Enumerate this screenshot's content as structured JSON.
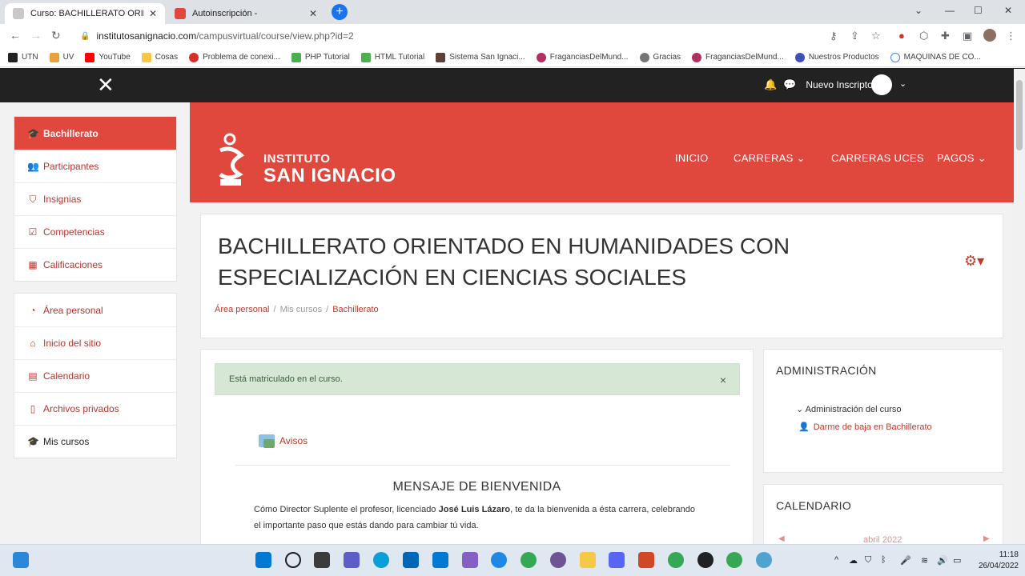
{
  "browser": {
    "tabs": [
      {
        "title": "Curso: BACHILLERATO ORIENTAD",
        "active": true
      },
      {
        "title": "Autoinscripción -",
        "active": false
      }
    ],
    "url_host": "institutosanignacio.com",
    "url_path": "/campusvirtual/course/view.php?id=2",
    "bookmarks": [
      "UTN",
      "UV",
      "YouTube",
      "Cosas",
      "Problema de conexi...",
      "PHP Tutorial",
      "HTML Tutorial",
      "Sistema San Ignaci...",
      "FraganciasDelMund...",
      "Gracias",
      "FraganciasDelMund...",
      "Nuestros Productos",
      "MAQUINAS DE CO..."
    ]
  },
  "moodle_nav": {
    "close_glyph": "✕",
    "user_name": "Nuevo Inscripto"
  },
  "sidebar": {
    "group1": [
      {
        "label": "Bachillerato",
        "icon": "graduation-cap-icon"
      },
      {
        "label": "Participantes",
        "icon": "users-icon"
      },
      {
        "label": "Insignias",
        "icon": "shield-icon"
      },
      {
        "label": "Competencias",
        "icon": "checkbox-icon"
      },
      {
        "label": "Calificaciones",
        "icon": "table-icon"
      }
    ],
    "group2": [
      {
        "label": "Área personal",
        "icon": "dashboard-icon"
      },
      {
        "label": "Inicio del sitio",
        "icon": "home-icon"
      },
      {
        "label": "Calendario",
        "icon": "calendar-icon"
      },
      {
        "label": "Archivos privados",
        "icon": "file-icon"
      },
      {
        "label": "Mis cursos",
        "icon": "graduation-cap-icon"
      }
    ]
  },
  "hero": {
    "logo_line1": "INSTITUTO",
    "logo_line2": "SAN IGNACIO",
    "menu": [
      "INICIO",
      "CARRERAS",
      "CARRERAS UCES",
      "PAGOS"
    ],
    "bg_color": "#e0473d"
  },
  "course": {
    "title": "BACHILLERATO ORIENTADO EN HUMANIDADES CON ESPECIALIZACIÓN EN CIENCIAS SOCIALES",
    "breadcrumb": [
      "Área personal",
      "Mis cursos",
      "Bachillerato"
    ]
  },
  "main": {
    "alert": "Está matriculado en el curso.",
    "forum_label": "Avisos",
    "welcome_title": "MENSAJE DE BIENVENIDA",
    "welcome_pre": "Cómo  Director Suplente el profesor, licenciado ",
    "welcome_name": "José Luis Lázaro",
    "welcome_post": ", te da la bienvenida a ésta carrera, celebrando el importante paso que estás dando para cambiar tú vida."
  },
  "blocks": {
    "admin_title": "ADMINISTRACIÓN",
    "admin_node": "Administración del curso",
    "admin_leaf": "Darme de baja en Bachillerato",
    "calendar_title": "CALENDARIO",
    "calendar_month": "abril 2022"
  },
  "taskbar": {
    "time": "11:18",
    "date": "26/04/2022"
  }
}
